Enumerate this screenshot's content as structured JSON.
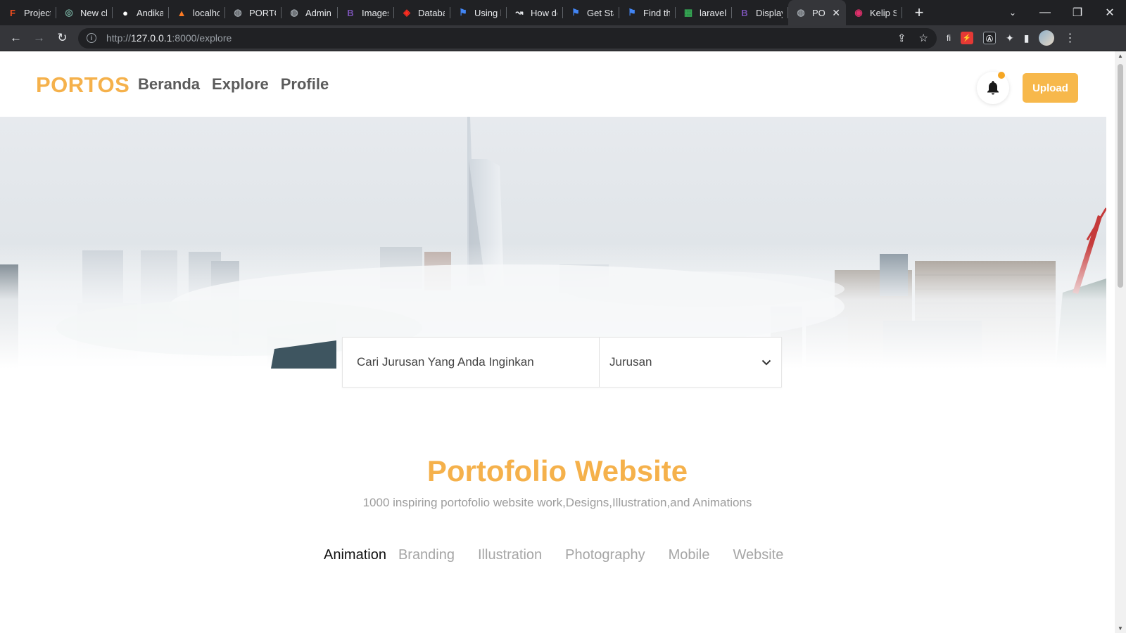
{
  "browser": {
    "tabs": [
      {
        "title": "Project",
        "icon": "figma-icon",
        "color": "#f24e1e"
      },
      {
        "title": "New ch",
        "icon": "chatgpt-icon",
        "color": "#74aa9c"
      },
      {
        "title": "Andika",
        "icon": "github-icon",
        "color": "#ffffff"
      },
      {
        "title": "localho",
        "icon": "xampp-icon",
        "color": "#fb7a24"
      },
      {
        "title": "PORTO",
        "icon": "globe-icon",
        "color": "#9aa0a6"
      },
      {
        "title": "Admin",
        "icon": "globe-icon",
        "color": "#9aa0a6"
      },
      {
        "title": "Images",
        "icon": "bootstrap-icon",
        "color": "#7952b3"
      },
      {
        "title": "Databa",
        "icon": "laravel-icon",
        "color": "#ff2d20"
      },
      {
        "title": "Using l",
        "icon": "flag-icon",
        "color": "#4285f4"
      },
      {
        "title": "How dc",
        "icon": "arrow-icon",
        "color": "#e8eaed"
      },
      {
        "title": "Get Sta",
        "icon": "flag-icon",
        "color": "#4285f4"
      },
      {
        "title": "Find th",
        "icon": "flag-icon",
        "color": "#4285f4"
      },
      {
        "title": "laravel",
        "icon": "sheets-icon",
        "color": "#34a853"
      },
      {
        "title": "Display",
        "icon": "bootstrap-icon",
        "color": "#7952b3"
      },
      {
        "title": "PO",
        "icon": "globe-icon",
        "color": "#9aa0a6",
        "active": true
      },
      {
        "title": "Kelip S",
        "icon": "instagram-icon",
        "color": "#e1306c"
      }
    ],
    "url_scheme": "http://",
    "url_host": "127.0.0.1",
    "url_rest": ":8000/explore",
    "window_controls": [
      "—",
      "❐",
      "✕"
    ]
  },
  "header": {
    "brand": "PORTOS",
    "nav": [
      "Beranda",
      "Explore",
      "Profile"
    ],
    "upload_label": "Upload"
  },
  "search": {
    "placeholder": "Cari Jurusan Yang Anda Inginkan",
    "select_value": "Jurusan"
  },
  "section": {
    "title": "Portofolio Website",
    "subtitle": "1000 inspiring portofolio website work,Designs,Illustration,and Animations"
  },
  "categories": [
    "Animation",
    "Branding",
    "Illustration",
    "Photography",
    "Mobile",
    "Website"
  ],
  "colors": {
    "accent": "#f5b14b",
    "upload_button": "#f7b84b",
    "notification_dot": "#f5a623"
  }
}
